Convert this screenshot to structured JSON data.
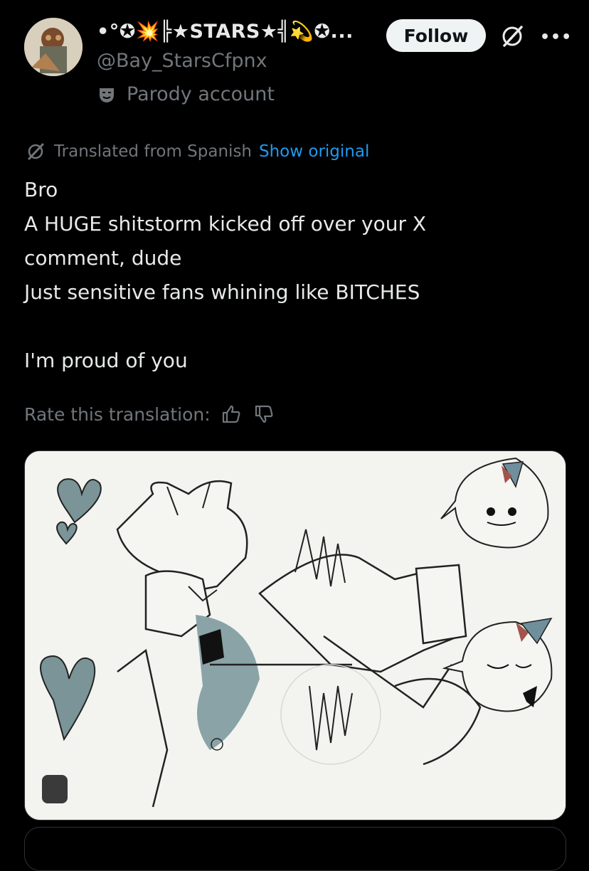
{
  "author": {
    "display_name": "•°✪💥╠★STARS★╣💫✪...",
    "handle": "@Bay_StarsCfpnx",
    "badge_label": "Parody account",
    "badge_icon": "mask-icon",
    "avatar_icon": "avatar-image"
  },
  "actions": {
    "follow_label": "Follow",
    "grok_icon": "grok-icon",
    "more_icon": "more-icon",
    "more_glyph": "•••"
  },
  "translation": {
    "label": "Translated from Spanish",
    "show_original": "Show original",
    "rate_label": "Rate this translation:",
    "up_icon": "thumb-up-icon",
    "down_icon": "thumb-down-icon"
  },
  "tweet": {
    "text": "Bro\nA HUGE shitstorm kicked off over your X\ncomment, dude\nJust sensitive fans whining like BITCHES\n\nI'm proud of you"
  },
  "colors": {
    "background": "#000000",
    "text": "#e7e9ea",
    "muted": "#71767b",
    "link": "#1d9bf0",
    "follow_bg": "#eff3f4"
  }
}
